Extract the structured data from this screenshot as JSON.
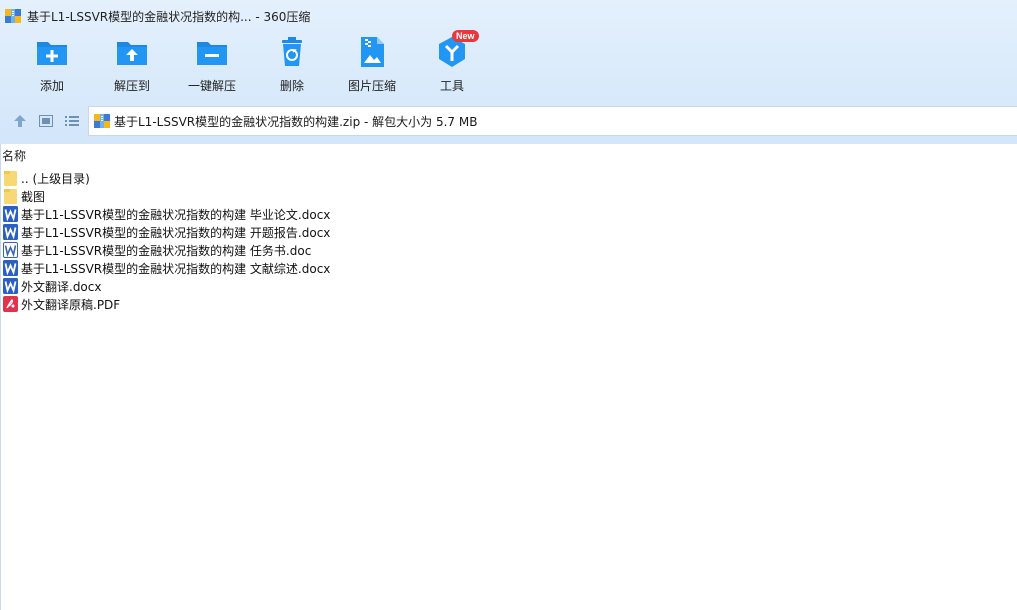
{
  "window": {
    "title": "基于L1-LSSVR模型的金融状况指数的构... - 360压缩"
  },
  "toolbar": {
    "items": [
      {
        "label": "添加",
        "icon": "add-icon"
      },
      {
        "label": "解压到",
        "icon": "extract-to-icon"
      },
      {
        "label": "一键解压",
        "icon": "one-click-extract-icon"
      },
      {
        "label": "删除",
        "icon": "delete-icon"
      },
      {
        "label": "图片压缩",
        "icon": "image-compress-icon"
      },
      {
        "label": "工具",
        "icon": "tools-icon",
        "badge": "New"
      }
    ]
  },
  "address": {
    "text": "基于L1-LSSVR模型的金融状况指数的构建.zip - 解包大小为 5.7 MB"
  },
  "filelist": {
    "column_name": "名称",
    "items": [
      {
        "name": ".. (上级目录)",
        "type": "folder"
      },
      {
        "name": "截图",
        "type": "folder"
      },
      {
        "name": "基于L1-LSSVR模型的金融状况指数的构建 毕业论文.docx",
        "type": "docx"
      },
      {
        "name": "基于L1-LSSVR模型的金融状况指数的构建 开题报告.docx",
        "type": "docx"
      },
      {
        "name": "基于L1-LSSVR模型的金融状况指数的构建 任务书.doc",
        "type": "doc"
      },
      {
        "name": "基于L1-LSSVR模型的金融状况指数的构建 文献综述.docx",
        "type": "docx"
      },
      {
        "name": "外文翻译.docx",
        "type": "docx"
      },
      {
        "name": "外文翻译原稿.PDF",
        "type": "pdf"
      }
    ]
  },
  "colors": {
    "accent_blue": "#1e88e5",
    "header_bg": "#dbebfb",
    "folder_yellow": "#f8d775",
    "word_blue": "#2b5fc4",
    "pdf_red": "#e0334c",
    "badge_red": "#e8383d"
  }
}
